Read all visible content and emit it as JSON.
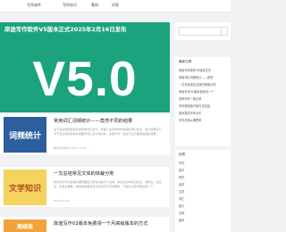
{
  "nav": [
    "写作软件",
    "写作技巧",
    "素材",
    "问答"
  ],
  "hero": {
    "title": "岸途写作软件V5版本正式2025年2月16日发布",
    "big": "V5.0",
    "bg": "#1ba37d"
  },
  "posts": [
    {
      "thumb": "词频统计",
      "thumb_bg": "#2d5f9f",
      "thumb_color": "#ffffff",
      "title": "常用词汇词频统计——竟然不同的结果",
      "excerpt": "关于最近刚刚搞完最常用的词汇统计，处理了在写作时候常用的词汇频次，统计结果如下，对于最近有好多朋友想要对词汇进行统计的，这里分享一些关于这方面的经验和结果。",
      "meta": "岸途写作软件  2024-11-22 ..."
    },
    {
      "thumb": "文学知识",
      "thumb_bg": "#f4d35e",
      "thumb_color": "#b44c1c",
      "title": "一文总结常见文体的体裁分类",
      "excerpt": "我们在写作之前首先要明确自己想写的是什么文体，常见的文体有记叙文、说明文、议论文、应用文等等，每种文体都有自己的特点与写作要求，下面为大家详细总结一下。",
      "meta": "2024-11-16 ..."
    },
    {
      "thumb": "高级版",
      "thumb_bg": "#f2a23a",
      "thumb_color": "#ffffff",
      "title": "岸途写作V2版本免费领一个月高级版本的方式",
      "excerpt": "",
      "meta": ""
    }
  ],
  "sidebar": {
    "search_placeholder": "",
    "latest_title": "最新文章",
    "latest": [
      "岸途写作软件V5版本正式",
      "常用词汇词频统计——竟然",
      "一文总结常见文体的体裁分类",
      "岸途写作V2版本免费领一个",
      "怎样写好一篇文章",
      "写作常用技巧和方法总结",
      "如何提高写作水平",
      "写作灵感从哪里来"
    ],
    "tags_title": "标签",
    "tags": [
      "写作",
      "技巧",
      "软件",
      "素材",
      "文学",
      "词汇",
      "统计",
      "文体",
      "版本"
    ]
  }
}
